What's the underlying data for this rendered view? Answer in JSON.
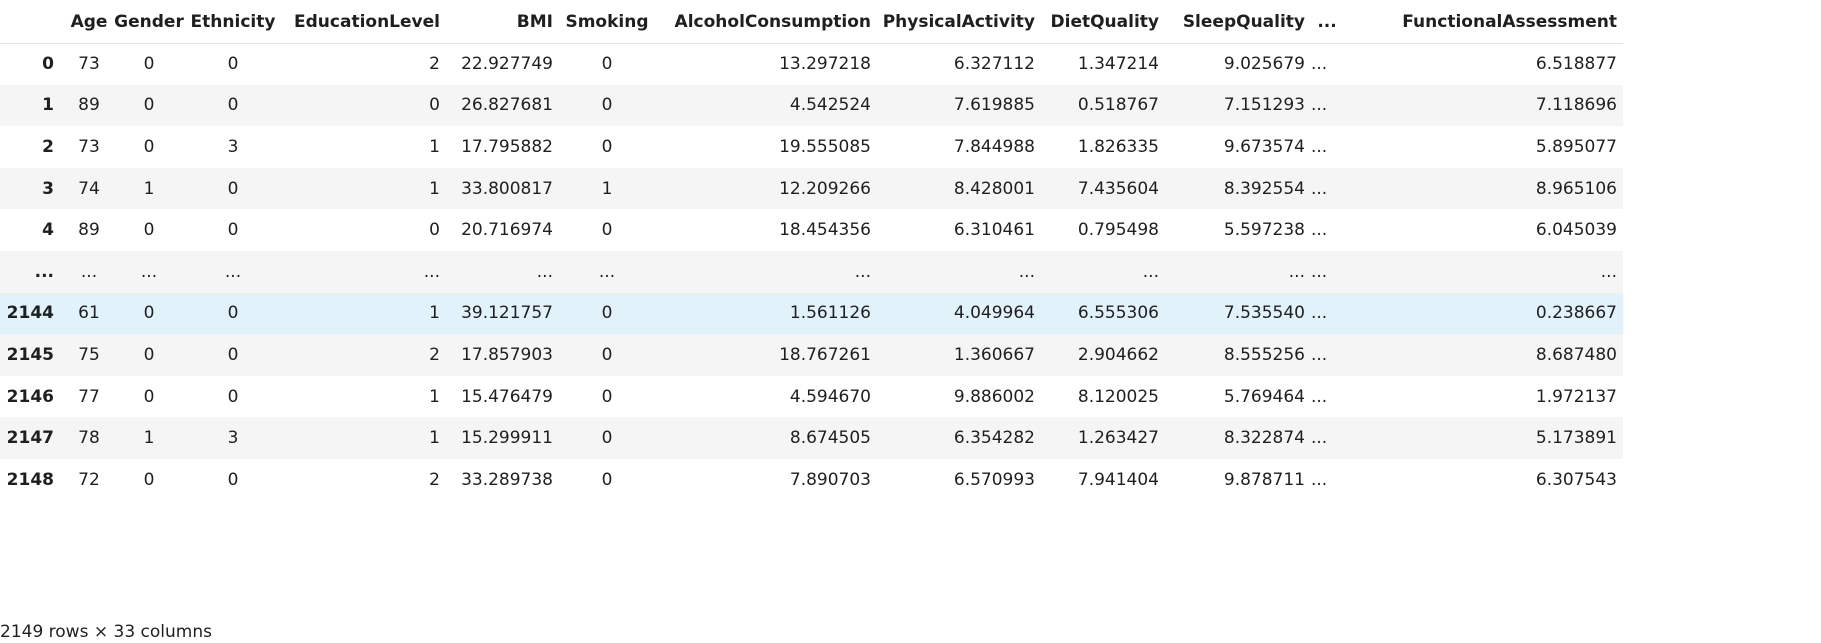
{
  "table": {
    "columns": [
      "",
      "Age",
      "Gender",
      "Ethnicity",
      "EducationLevel",
      "BMI",
      "Smoking",
      "AlcoholConsumption",
      "PhysicalActivity",
      "DietQuality",
      "SleepQuality",
      "...",
      "FunctionalAssessment"
    ],
    "rows": [
      {
        "index": "0",
        "cells": [
          "73",
          "0",
          "0",
          "2",
          "22.927749",
          "0",
          "13.297218",
          "6.327112",
          "1.347214",
          "9.025679",
          "...",
          "6.518877"
        ]
      },
      {
        "index": "1",
        "cells": [
          "89",
          "0",
          "0",
          "0",
          "26.827681",
          "0",
          "4.542524",
          "7.619885",
          "0.518767",
          "7.151293",
          "...",
          "7.118696"
        ]
      },
      {
        "index": "2",
        "cells": [
          "73",
          "0",
          "3",
          "1",
          "17.795882",
          "0",
          "19.555085",
          "7.844988",
          "1.826335",
          "9.673574",
          "...",
          "5.895077"
        ]
      },
      {
        "index": "3",
        "cells": [
          "74",
          "1",
          "0",
          "1",
          "33.800817",
          "1",
          "12.209266",
          "8.428001",
          "7.435604",
          "8.392554",
          "...",
          "8.965106"
        ]
      },
      {
        "index": "4",
        "cells": [
          "89",
          "0",
          "0",
          "0",
          "20.716974",
          "0",
          "18.454356",
          "6.310461",
          "0.795498",
          "5.597238",
          "...",
          "6.045039"
        ]
      },
      {
        "index": "...",
        "cells": [
          "...",
          "...",
          "...",
          "...",
          "...",
          "...",
          "...",
          "...",
          "...",
          "...",
          "...",
          "..."
        ]
      },
      {
        "index": "2144",
        "cells": [
          "61",
          "0",
          "0",
          "1",
          "39.121757",
          "0",
          "1.561126",
          "4.049964",
          "6.555306",
          "7.535540",
          "...",
          "0.238667"
        ]
      },
      {
        "index": "2145",
        "cells": [
          "75",
          "0",
          "0",
          "2",
          "17.857903",
          "0",
          "18.767261",
          "1.360667",
          "2.904662",
          "8.555256",
          "...",
          "8.687480"
        ]
      },
      {
        "index": "2146",
        "cells": [
          "77",
          "0",
          "0",
          "1",
          "15.476479",
          "0",
          "4.594670",
          "9.886002",
          "8.120025",
          "5.769464",
          "...",
          "1.972137"
        ]
      },
      {
        "index": "2147",
        "cells": [
          "78",
          "1",
          "3",
          "1",
          "15.299911",
          "0",
          "8.674505",
          "6.354282",
          "1.263427",
          "8.322874",
          "...",
          "5.173891"
        ]
      },
      {
        "index": "2148",
        "cells": [
          "72",
          "0",
          "0",
          "2",
          "33.289738",
          "0",
          "7.890703",
          "6.570993",
          "7.941404",
          "9.878711",
          "...",
          "6.307543"
        ]
      }
    ]
  },
  "footer": {
    "shape_text": "2149 rows × 33 columns"
  },
  "colors": {
    "stripe": "#f5f5f5",
    "hover_row": "#e1f2fb",
    "text": "#1f1f1f"
  }
}
